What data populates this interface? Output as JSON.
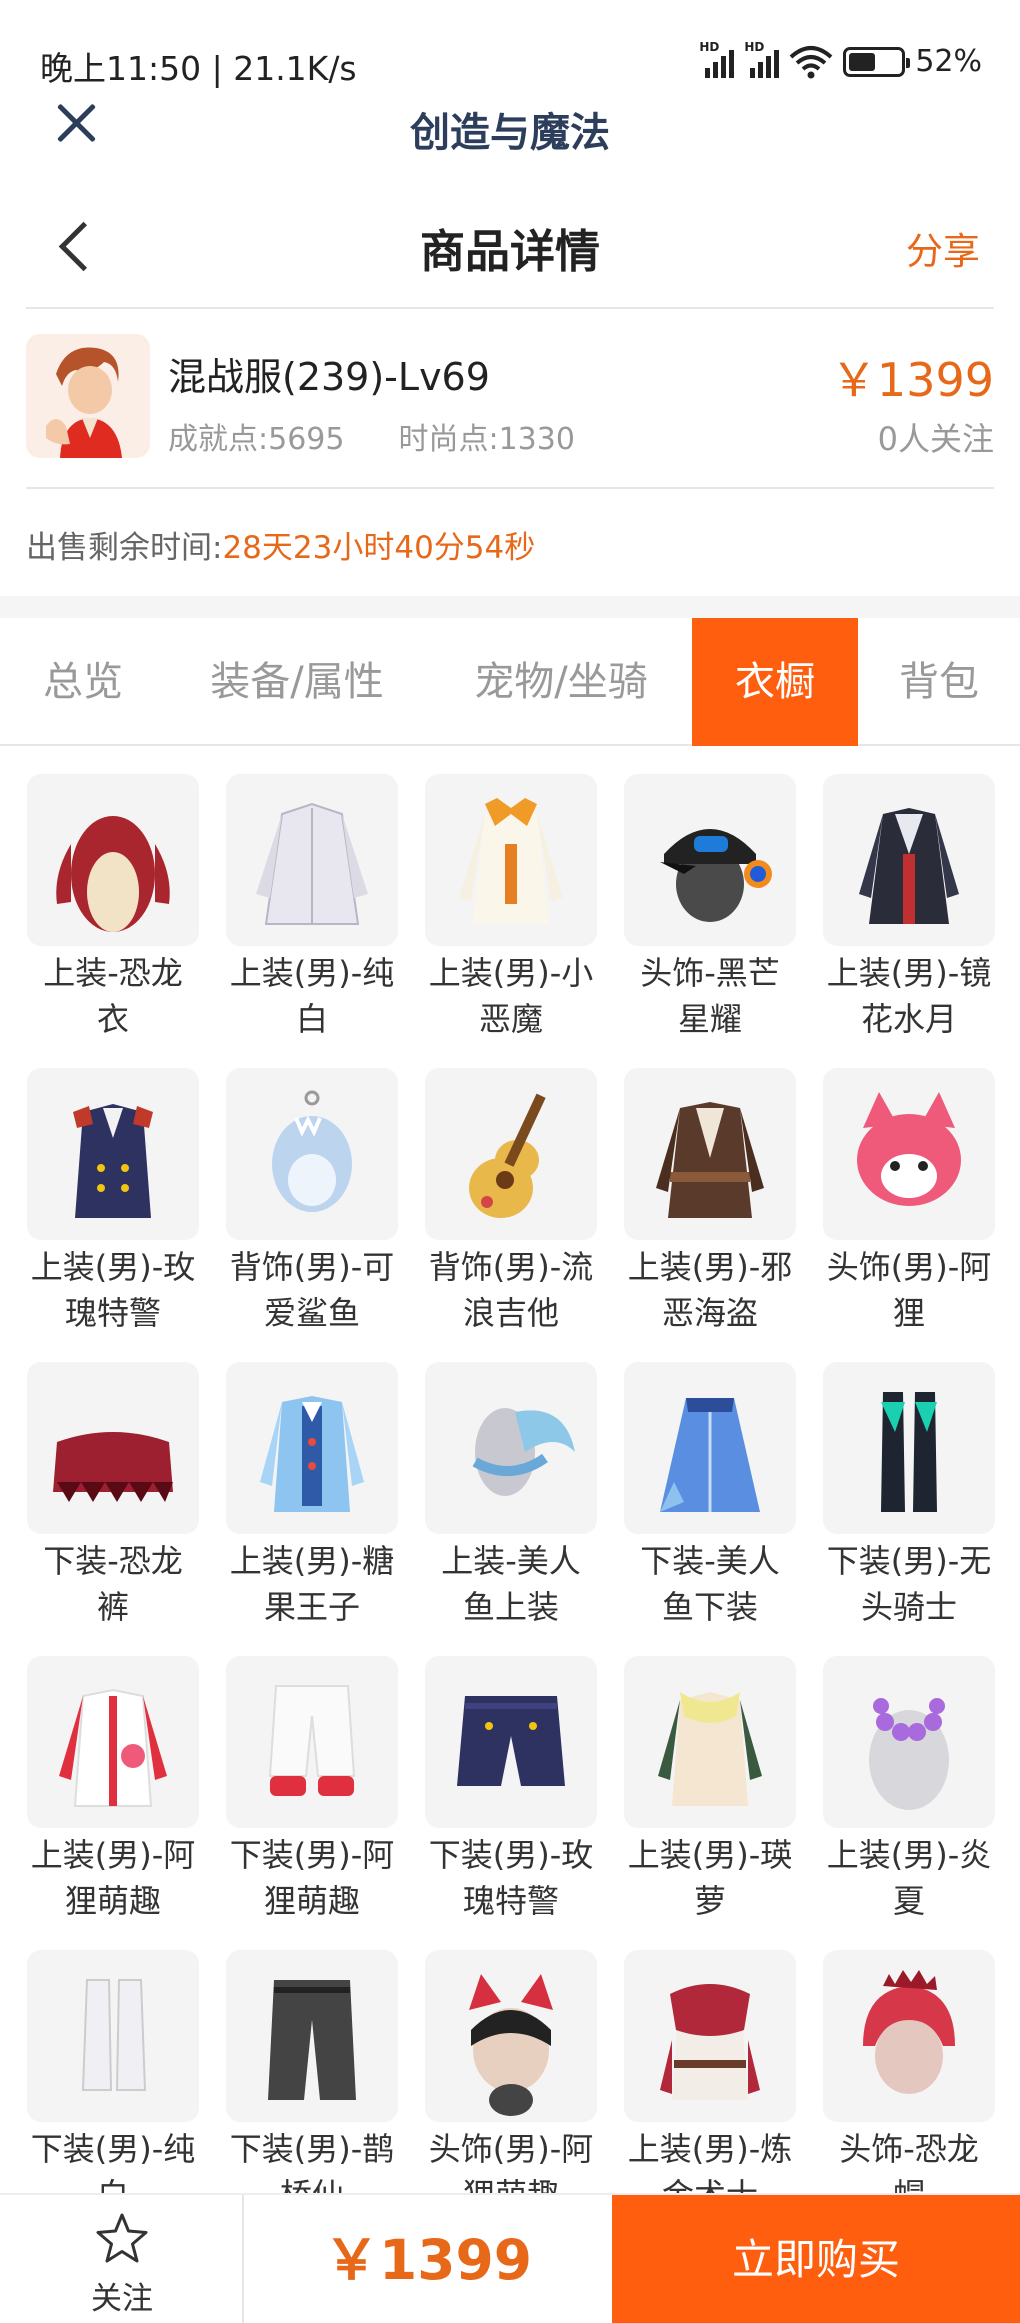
{
  "status_bar": {
    "time_speed": "晚上11:50 | 21.1K/s",
    "battery": "52%",
    "signal_label": "HD",
    "battery_level": 0.52
  },
  "app_header": {
    "title": "创造与魔法"
  },
  "page_header": {
    "title": "商品详情",
    "share_label": "分享"
  },
  "product": {
    "name": "混战服(239)-Lv69",
    "achievement": "成就点:5695",
    "fashion": "时尚点:1330",
    "price": "￥1399",
    "followers": "0人关注"
  },
  "timer": {
    "label": "出售剩余时间:",
    "value": "28天23小时40分54秒"
  },
  "tabs": [
    {
      "label": "总览"
    },
    {
      "label": "装备/属性"
    },
    {
      "label": "宠物/坐骑"
    },
    {
      "label": "衣橱"
    },
    {
      "label": "背包"
    }
  ],
  "active_tab": "衣橱",
  "wardrobe": [
    {
      "line1": "上装-恐龙",
      "line2": "衣",
      "icon": "dino-top-icon"
    },
    {
      "line1": "上装(男)-纯",
      "line2": "白",
      "icon": "white-coat-icon"
    },
    {
      "line1": "上装(男)-小",
      "line2": "恶魔",
      "icon": "little-devil-coat-icon"
    },
    {
      "line1": "头饰-黑芒",
      "line2": "星耀",
      "icon": "cap-headphones-icon"
    },
    {
      "line1": "上装(男)-镜",
      "line2": "花水月",
      "icon": "mirror-coat-icon"
    },
    {
      "line1": "上装(男)-玫",
      "line2": "瑰特警",
      "icon": "rose-police-coat-icon"
    },
    {
      "line1": "背饰(男)-可",
      "line2": "爱鲨鱼",
      "icon": "shark-backpack-icon"
    },
    {
      "line1": "背饰(男)-流",
      "line2": "浪吉他",
      "icon": "guitar-icon"
    },
    {
      "line1": "上装(男)-邪",
      "line2": "恶海盗",
      "icon": "pirate-coat-icon"
    },
    {
      "line1": "头饰(男)-阿",
      "line2": "狸",
      "icon": "fox-head-icon"
    },
    {
      "line1": "下装-恐龙",
      "line2": "裤",
      "icon": "dino-pants-icon"
    },
    {
      "line1": "上装(男)-糖",
      "line2": "果王子",
      "icon": "candy-prince-coat-icon"
    },
    {
      "line1": "上装-美人",
      "line2": "鱼上装",
      "icon": "mermaid-top-icon"
    },
    {
      "line1": "下装-美人",
      "line2": "鱼下装",
      "icon": "mermaid-skirt-icon"
    },
    {
      "line1": "下装(男)-无",
      "line2": "头骑士",
      "icon": "knight-boots-icon"
    },
    {
      "line1": "上装(男)-阿",
      "line2": "狸萌趣",
      "icon": "fox-jacket-icon"
    },
    {
      "line1": "下装(男)-阿",
      "line2": "狸萌趣",
      "icon": "fox-pants-icon"
    },
    {
      "line1": "下装(男)-玫",
      "line2": "瑰特警",
      "icon": "police-shorts-icon"
    },
    {
      "line1": "上装(男)-瑛",
      "line2": "萝",
      "icon": "scarf-top-icon"
    },
    {
      "line1": "上装(男)-炎",
      "line2": "夏",
      "icon": "lei-necklace-icon"
    },
    {
      "line1": "下装(男)-纯",
      "line2": "白",
      "icon": "white-boots-icon"
    },
    {
      "line1": "下装(男)-鹊",
      "line2": "桥仙",
      "icon": "black-pants-icon"
    },
    {
      "line1": "头饰(男)-阿",
      "line2": "狸萌趣",
      "icon": "fox-ear-hair-icon"
    },
    {
      "line1": "上装(男)-炼",
      "line2": "金术士",
      "icon": "alchemist-coat-icon"
    },
    {
      "line1": "头饰-恐龙",
      "line2": "帽",
      "icon": "dino-hat-icon"
    }
  ],
  "bottom_bar": {
    "follow_label": "关注",
    "price": "￥1399",
    "buy_label": "立即购买"
  },
  "colors": {
    "accent": "#ff5e0e",
    "price": "#e8681a",
    "title": "#2c3e5c"
  }
}
